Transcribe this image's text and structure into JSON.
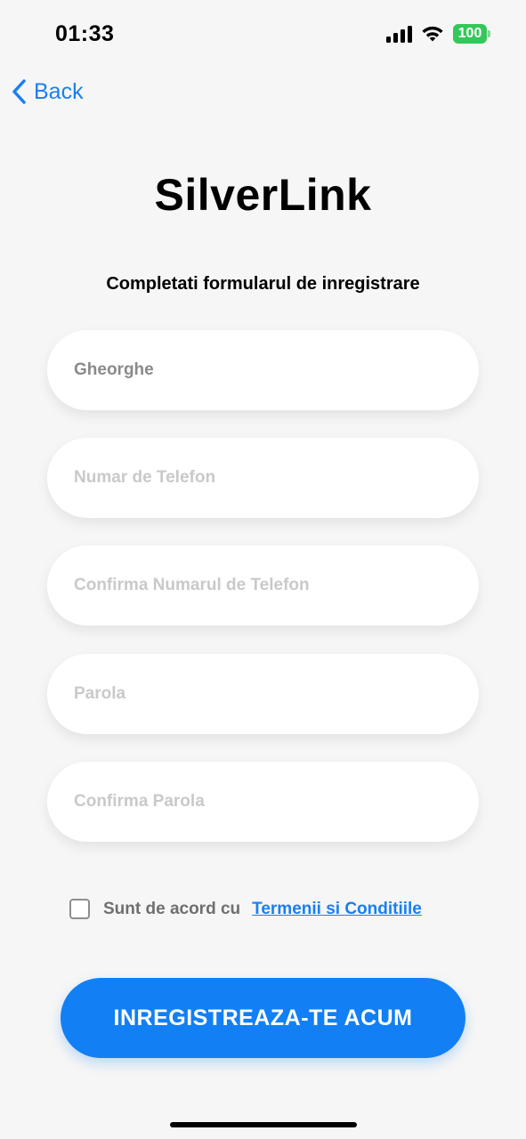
{
  "status_bar": {
    "time": "01:33",
    "battery": "100",
    "icons": [
      "signal-icon",
      "wifi-icon",
      "battery-icon"
    ]
  },
  "nav": {
    "back_label": "Back",
    "back_icon": "chevron-left-icon"
  },
  "header": {
    "title": "SilverLink",
    "subtitle": "Completati formularul de inregistrare"
  },
  "form": {
    "fields": [
      {
        "name": "first-name-field",
        "value": "Gheorghe",
        "placeholder": ""
      },
      {
        "name": "phone-field",
        "value": "",
        "placeholder": "Numar de Telefon"
      },
      {
        "name": "confirm-phone-field",
        "value": "",
        "placeholder": "Confirma Numarul de Telefon"
      },
      {
        "name": "password-field",
        "value": "",
        "placeholder": "Parola"
      },
      {
        "name": "confirm-password-field",
        "value": "",
        "placeholder": "Confirma Parola"
      }
    ],
    "terms_text": "Sunt de acord cu",
    "terms_link": "Termenii si Conditiile",
    "terms_checked": false,
    "submit_label": "INREGISTREAZA-TE ACUM"
  },
  "colors": {
    "accent": "#127ff5",
    "link": "#1a7ff0",
    "battery": "#34c759",
    "background": "#f6f6f6"
  }
}
